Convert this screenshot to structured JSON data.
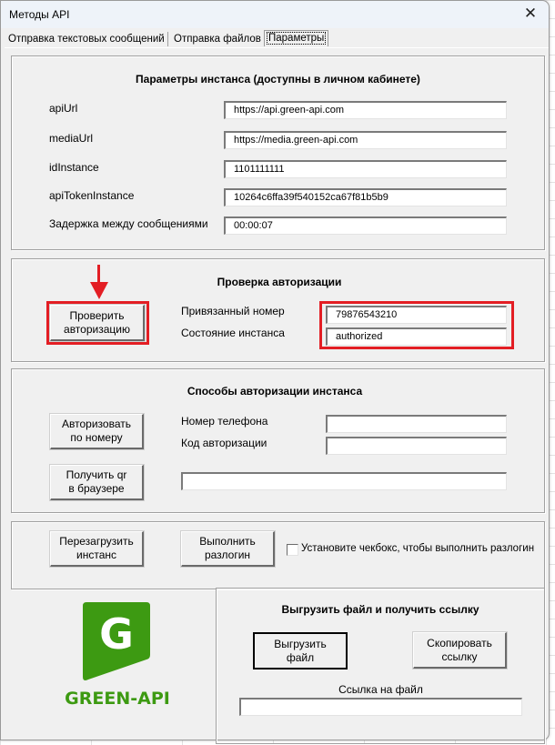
{
  "window": {
    "title": "Методы API",
    "close_icon": "close-icon"
  },
  "tabs": [
    {
      "label": "Отправка текстовых сообщений",
      "active": false
    },
    {
      "label": "Отправка файлов",
      "active": false
    },
    {
      "label": "Параметры",
      "active": true
    }
  ],
  "instance_params": {
    "heading": "Параметры инстанса (доступны в личном кабинете)",
    "fields": [
      {
        "label": "apiUrl",
        "value": "https://api.green-api.com"
      },
      {
        "label": "mediaUrl",
        "value": "https://media.green-api.com"
      },
      {
        "label": "idInstance",
        "value": "1101111111"
      },
      {
        "label": "apiTokenInstance",
        "value": "10264c6ffa39f540152ca67f81b5b9"
      },
      {
        "label": "Задержка между сообщениями",
        "value": "00:00:07"
      }
    ]
  },
  "auth_check": {
    "heading": "Проверка авторизации",
    "check_button": "Проверить\nавторизацию",
    "linked_number_label": "Привязанный номер",
    "linked_number_value": "79876543210",
    "state_label": "Состояние инстанса",
    "state_value": "authorized",
    "highlight_color": "#e31e24"
  },
  "auth_methods": {
    "heading": "Способы авторизации инстанса",
    "by_number_button": "Авторизовать\nпо номеру",
    "phone_label": "Номер телефона",
    "phone_value": "",
    "code_label": "Код авторизации",
    "code_value": "",
    "qr_button": "Получить qr\nв браузере",
    "qr_value": ""
  },
  "instance_actions": {
    "reboot_button": "Перезагрузить\nинстанс",
    "logout_button": "Выполнить\nразлогин",
    "logout_checkbox_label": "Установите чекбокс, чтобы выполнить разлогин",
    "logout_checkbox_checked": false
  },
  "upload": {
    "heading": "Выгрузить файл и получить ссылку",
    "upload_button": "Выгрузить\nфайл",
    "copy_button": "Скопировать\nссылку",
    "link_label": "Ссылка на файл",
    "link_value": ""
  },
  "logo": {
    "text": "GREEN-API",
    "letter": "G",
    "color": "#3d9a12"
  }
}
